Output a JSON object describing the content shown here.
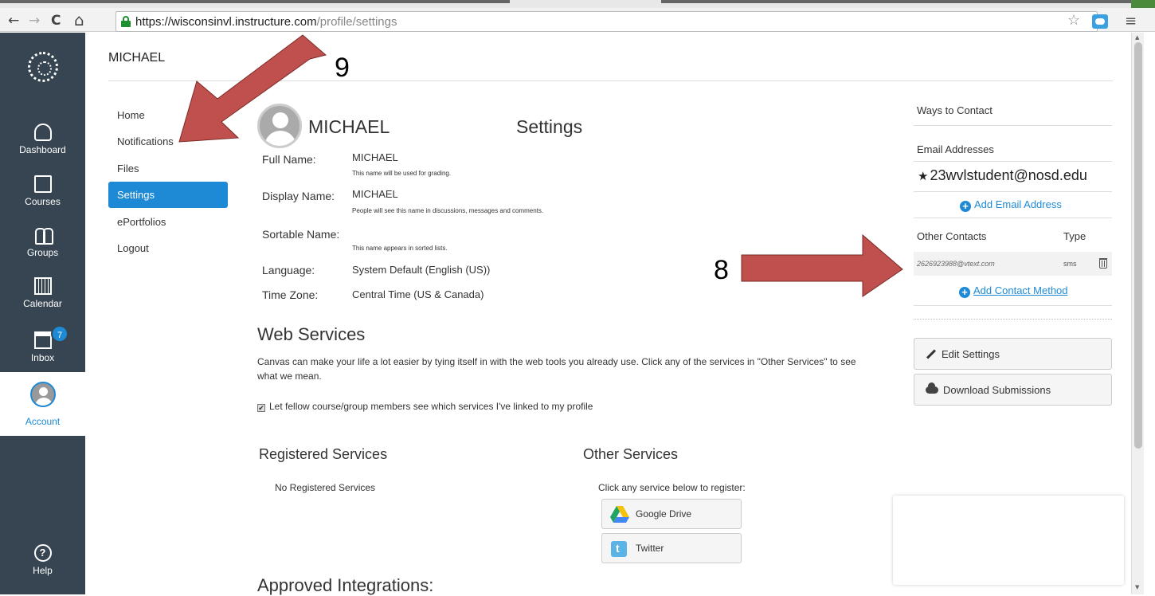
{
  "browser": {
    "url_host": "https://wisconsinvl.instructure.com",
    "url_path": "/profile/settings",
    "back_glyph": "←",
    "forward_glyph": "→",
    "reload_glyph": "C",
    "home_glyph": "⌂",
    "star_glyph": "☆",
    "menu_glyph": "≡"
  },
  "global_nav": {
    "dashboard": "Dashboard",
    "courses": "Courses",
    "groups": "Groups",
    "calendar": "Calendar",
    "inbox": "Inbox",
    "inbox_badge": "7",
    "account": "Account",
    "help": "Help",
    "help_glyph": "?"
  },
  "header": {
    "user_name": "MICHAEL"
  },
  "left_nav": {
    "home": "Home",
    "notifications": "Notifications",
    "files": "Files",
    "settings": "Settings",
    "eportfolios": "ePortfolios",
    "logout": "Logout"
  },
  "profile": {
    "name": "MICHAEL",
    "title": "Settings",
    "full_name_label": "Full Name:",
    "full_name_value": "MICHAEL",
    "full_name_hint": "This name will be used for grading.",
    "display_name_label": "Display Name:",
    "display_name_value": "MICHAEL",
    "display_name_hint": "People will see this name in discussions, messages and comments.",
    "sortable_name_label": "Sortable Name:",
    "sortable_name_hint": "This name appears in sorted lists.",
    "language_label": "Language:",
    "language_value": "System Default (English (US))",
    "timezone_label": "Time Zone:",
    "timezone_value": "Central Time (US & Canada)"
  },
  "web_services": {
    "heading": "Web Services",
    "description": "Canvas can make your life a lot easier by tying itself in with the web tools you already use. Click any of the services in \"Other Services\" to see what we mean.",
    "checkbox_label": "Let fellow course/group members see which services I've linked to my profile",
    "checkbox_glyph": "✔",
    "registered_heading": "Registered Services",
    "registered_none": "No Registered Services",
    "other_heading": "Other Services",
    "other_hint": "Click any service below to register:",
    "google_drive": "Google Drive",
    "twitter": "Twitter",
    "approved_heading": "Approved Integrations:"
  },
  "sidebar": {
    "ways_to_contact": "Ways to Contact",
    "email_heading": "Email Addresses",
    "email_star": "★",
    "email": "23wvlstudent@nosd.edu",
    "add_email": "Add Email Address",
    "other_contacts": "Other Contacts",
    "type": "Type",
    "contact_address": "2626923988@vtext.com",
    "contact_type": "sms",
    "add_contact": "Add Contact Method",
    "plus_glyph": "+",
    "edit_settings": "Edit Settings",
    "download_submissions": "Download Submissions"
  },
  "annotations": {
    "label_9": "9",
    "label_8": "8",
    "arrow_color": "#c0504d"
  }
}
